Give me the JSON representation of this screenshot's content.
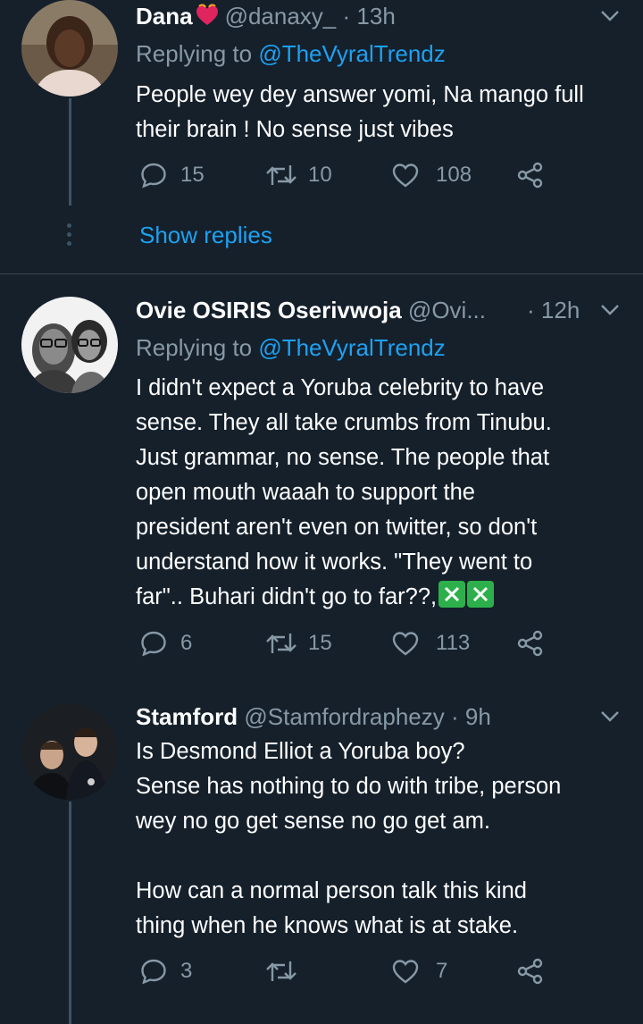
{
  "tweets": [
    {
      "name": "Dana",
      "handle": "@danaxy_",
      "dot": "·",
      "time": "13h",
      "replying_prefix": "Replying to",
      "replying_to": "@TheVyralTrendz",
      "body": "People wey dey answer yomi, Na mango full their brain ! No sense just vibes",
      "replies": "15",
      "retweets": "10",
      "likes": "108",
      "show_replies": "Show replies"
    },
    {
      "name": "Ovie OSIRIS Oserivwoja",
      "handle": "@Ovi...",
      "dot": "·",
      "time": "12h",
      "replying_prefix": "Replying to",
      "replying_to": "@TheVyralTrendz",
      "body_lines": [
        "I didn't expect a Yoruba celebrity to have",
        "sense. They all take crumbs from Tinubu.",
        "Just grammar, no sense. The people that",
        "open mouth waaah to support the",
        "president aren't even on twitter, so don't",
        "understand how it works. \"They went to",
        "far\".. Buhari didn't go to far??,"
      ],
      "replies": "6",
      "retweets": "15",
      "likes": "113"
    },
    {
      "name": "Stamford",
      "handle": "@Stamfordraphezy",
      "dot": "·",
      "time": "9h",
      "body_lines": [
        "Is Desmond Elliot a Yoruba boy?",
        "Sense has nothing to do with tribe, person",
        "wey no go get sense no go get am.",
        "",
        "How can a normal person talk this kind",
        "thing when he knows what is at stake."
      ],
      "replies": "3",
      "retweets": "",
      "likes": "7"
    }
  ],
  "icons": {
    "reply": "reply-icon",
    "retweet": "retweet-icon",
    "like": "heart-icon",
    "share": "share-icon",
    "menu": "chevron-down-icon",
    "emoji": "red-heart-emoji",
    "check": "cross-mark-button-emoji"
  },
  "colors": {
    "background": "#15202b",
    "secondary_text": "#8899a6",
    "link": "#1da1f2",
    "separator": "#38444d"
  }
}
